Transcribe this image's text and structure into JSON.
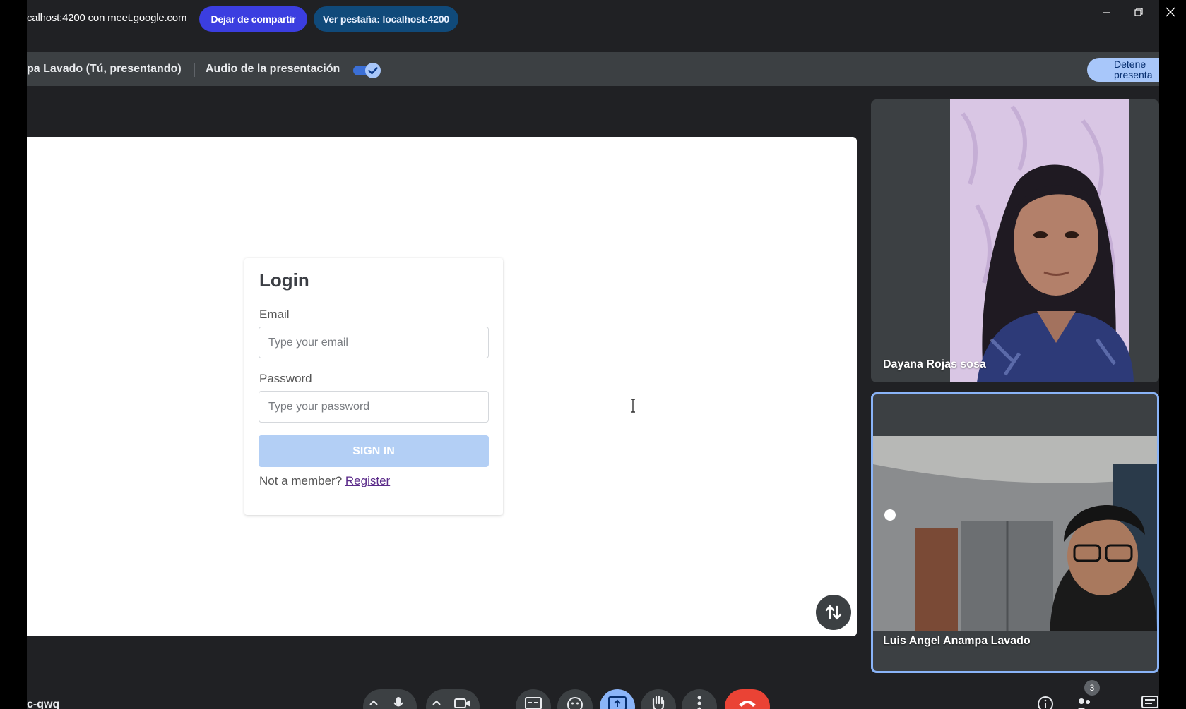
{
  "share_bar": {
    "text": "calhost:4200 con meet.google.com",
    "stop_sharing_label": "Dejar de compartir",
    "view_tab_label": "Ver pestaña: localhost:4200"
  },
  "present_bar": {
    "presenter": "pa Lavado (Tú, presentando)",
    "audio_label": "Audio de la presentación",
    "audio_enabled": true,
    "stop_presenting_label": "Detene presenta"
  },
  "shared_page": {
    "title": "Login",
    "email_label": "Email",
    "email_placeholder": "Type your email",
    "password_label": "Password",
    "password_placeholder": "Type your password",
    "signin_label": "SIGN IN",
    "member_text": "Not a member? ",
    "register_label": "Register"
  },
  "participants": [
    {
      "name": "Dayana Rojas sosa"
    },
    {
      "name": "Luis Angel Anampa Lavado"
    }
  ],
  "bottom": {
    "meeting_code": "c-qwq",
    "people_count": "3"
  },
  "colors": {
    "meet_bg": "#202124",
    "stop_sharing": "#3b3ee0",
    "view_tab": "#104a7a",
    "accent": "#8ab4f8",
    "end_call": "#ea4335"
  }
}
